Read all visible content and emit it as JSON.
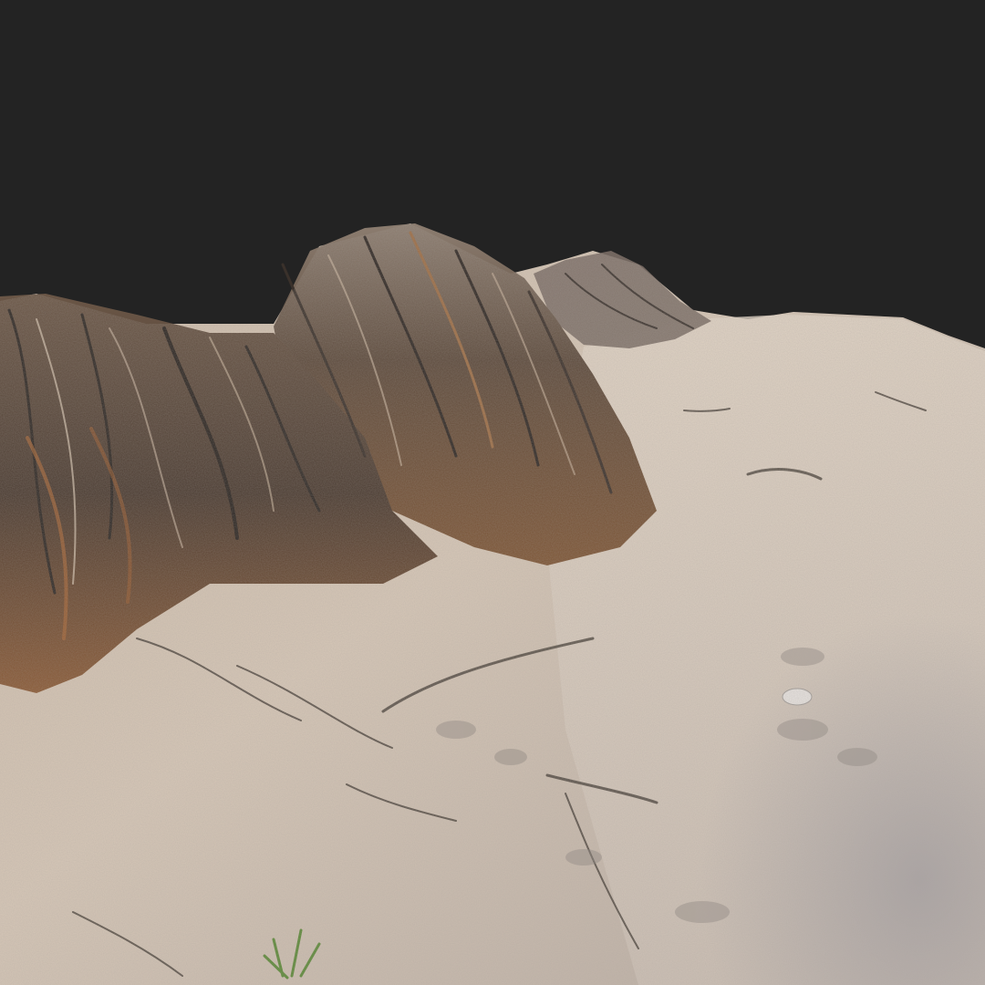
{
  "scene": {
    "subject": "sand-dune-with-exposed-roots",
    "colors": {
      "background": "#232323",
      "sand_light": "#d9cbbb",
      "sand_mid": "#b9a794",
      "sand_shadow": "#8f8c91",
      "root_dark": "#3a342f",
      "root_brown": "#7a4e2e",
      "root_orange": "#a8683a",
      "grass_green": "#5d8a3a"
    }
  }
}
